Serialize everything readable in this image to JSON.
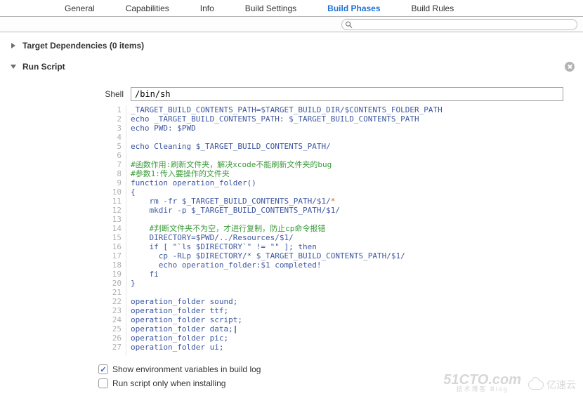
{
  "tabs": {
    "items": [
      {
        "label": "General"
      },
      {
        "label": "Capabilities"
      },
      {
        "label": "Info"
      },
      {
        "label": "Build Settings"
      },
      {
        "label": "Build Phases"
      },
      {
        "label": "Build Rules"
      }
    ],
    "active_index": 4
  },
  "filter": {
    "placeholder": ""
  },
  "phases": {
    "target_deps": {
      "title": "Target Dependencies",
      "count_label": "(0 items)"
    },
    "run_script": {
      "title": "Run Script"
    }
  },
  "shell": {
    "label": "Shell",
    "value": "/bin/sh"
  },
  "code_lines": [
    {
      "n": 1,
      "cls": "plain",
      "text": "_TARGET_BUILD_CONTENTS_PATH=$TARGET_BUILD_DIR/$CONTENTS_FOLDER_PATH"
    },
    {
      "n": 2,
      "cls": "plain",
      "text": "echo _TARGET_BUILD_CONTENTS_PATH: $_TARGET_BUILD_CONTENTS_PATH"
    },
    {
      "n": 3,
      "cls": "plain",
      "text": "echo PWD: $PWD"
    },
    {
      "n": 4,
      "cls": "plain",
      "text": ""
    },
    {
      "n": 5,
      "cls": "plain",
      "text": "echo Cleaning $_TARGET_BUILD_CONTENTS_PATH/"
    },
    {
      "n": 6,
      "cls": "plain",
      "text": ""
    },
    {
      "n": 7,
      "cls": "comment",
      "text": "#函数作用:刷新文件夹，解决xcode不能刷新文件夹的bug"
    },
    {
      "n": 8,
      "cls": "comment",
      "text": "#参数1:传入要操作的文件夹"
    },
    {
      "n": 9,
      "cls": "plain",
      "text": "function operation_folder()"
    },
    {
      "n": 10,
      "cls": "plain",
      "text": "{"
    },
    {
      "n": 11,
      "cls": "rmstar",
      "prefix": "    rm -fr $_TARGET_BUILD_CONTENTS_PATH/$1/",
      "star": "*"
    },
    {
      "n": 12,
      "cls": "plain",
      "text": "    mkdir -p $_TARGET_BUILD_CONTENTS_PATH/$1/"
    },
    {
      "n": 13,
      "cls": "plain",
      "text": ""
    },
    {
      "n": 14,
      "cls": "comment",
      "text": "    #判断文件夹不为空，才进行复制，防止cp命令报错"
    },
    {
      "n": 15,
      "cls": "plain",
      "text": "    DIRECTORY=$PWD/../Resources/$1/"
    },
    {
      "n": 16,
      "cls": "plain",
      "text": "    if [ \"`ls $DIRECTORY`\" != \"\" ]; then"
    },
    {
      "n": 17,
      "cls": "plain",
      "text": "      cp -RLp $DIRECTORY/* $_TARGET_BUILD_CONTENTS_PATH/$1/"
    },
    {
      "n": 18,
      "cls": "plain",
      "text": "      echo operation_folder:$1 completed!"
    },
    {
      "n": 19,
      "cls": "plain",
      "text": "    fi"
    },
    {
      "n": 20,
      "cls": "plain",
      "text": "}"
    },
    {
      "n": 21,
      "cls": "plain",
      "text": ""
    },
    {
      "n": 22,
      "cls": "plain",
      "text": "operation_folder sound;"
    },
    {
      "n": 23,
      "cls": "plain",
      "text": "operation_folder ttf;"
    },
    {
      "n": 24,
      "cls": "plain",
      "text": "operation_folder script;"
    },
    {
      "n": 25,
      "cls": "caret",
      "pre": "operation_folder data;",
      "post": ""
    },
    {
      "n": 26,
      "cls": "plain",
      "text": "operation_folder pic;"
    },
    {
      "n": 27,
      "cls": "plain",
      "text": "operation_folder ui;"
    }
  ],
  "checks": {
    "env_vars": "Show environment variables in build log",
    "only_install": "Run script only when installing"
  },
  "watermark": {
    "a_top": "51CTO.com",
    "a_bottom": "技术博客 Blog",
    "b": "亿速云"
  }
}
